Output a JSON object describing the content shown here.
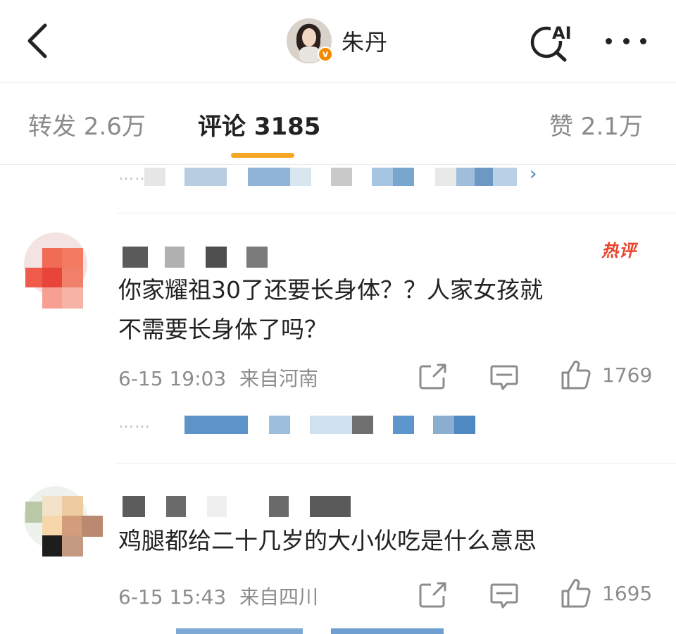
{
  "header": {
    "username": "朱丹",
    "verified_badge": "v",
    "ai_label": "AI",
    "icons": {
      "back": "chevron-left-icon",
      "ai_search": "ai-search-icon",
      "more": "more-dots-icon"
    }
  },
  "tabs": [
    {
      "label": "转发 2.6万",
      "active": false
    },
    {
      "label": "评论 3185",
      "active": true
    },
    {
      "label": "赞 2.1万",
      "active": false
    }
  ],
  "colors": {
    "accent": "#f5a623",
    "hot": "#e8432c",
    "verified": "#f28b00",
    "muted": "#8c8c8c",
    "link": "#4a7fc0"
  },
  "comments": [
    {
      "badge": "热评",
      "text_line1": "你家耀祖30了还要长身体？？人家女孩就",
      "text_line2": "不需要长身体了吗？",
      "time": "6-15 19:03",
      "location": "来自河南",
      "likes": "1769",
      "reply_dots": "……"
    },
    {
      "text_line1": "鸡腿都给二十几岁的大小伙吃是什么意思",
      "time": "6-15 15:43",
      "location": "来自四川",
      "likes": "1695"
    }
  ],
  "sub_reply": {
    "dots": "……",
    "more_icon": "chevron-right-icon"
  }
}
